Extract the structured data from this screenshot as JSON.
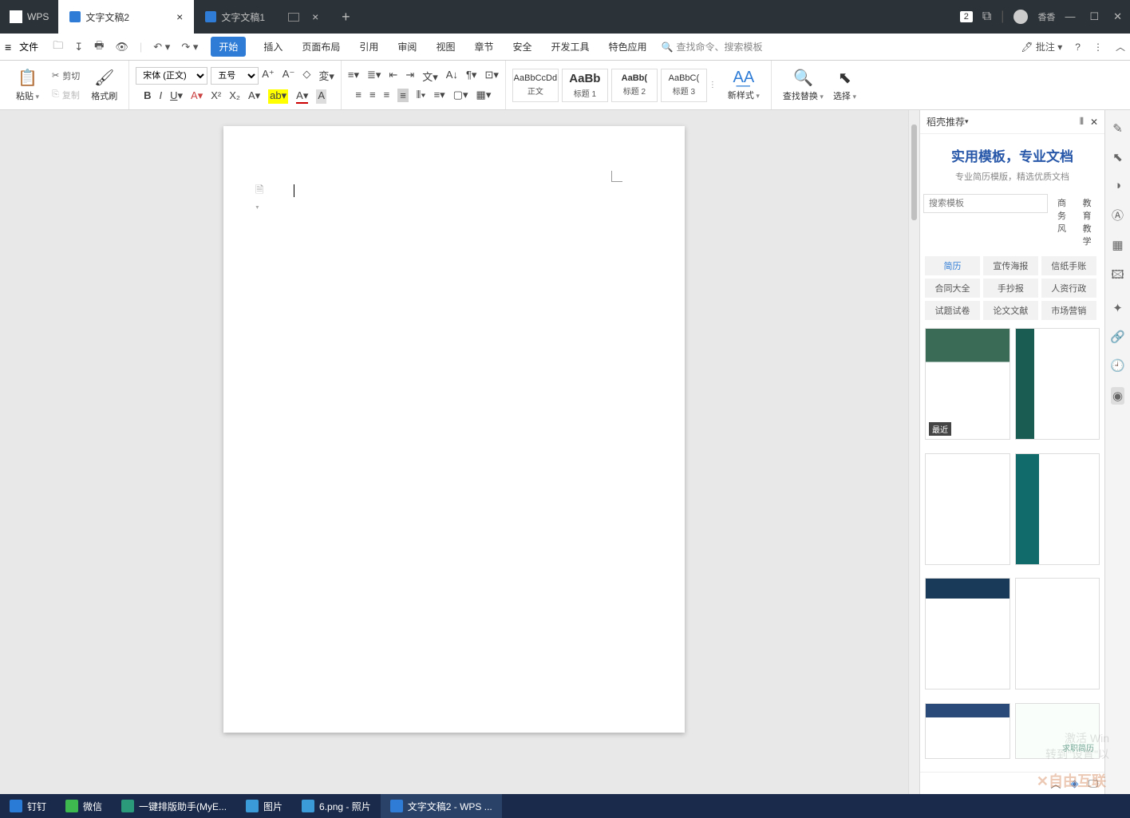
{
  "titlebar": {
    "app_name": "WPS",
    "tabs": [
      {
        "label": "文字文稿2",
        "active": true
      },
      {
        "label": "文字文稿1",
        "active": false
      }
    ],
    "notification_count": "2",
    "user_name": "香香"
  },
  "menubar": {
    "file_label": "文件",
    "tabs": [
      "开始",
      "插入",
      "页面布局",
      "引用",
      "审阅",
      "视图",
      "章节",
      "安全",
      "开发工具",
      "特色应用"
    ],
    "active_tab": "开始",
    "search_placeholder": "查找命令、搜索模板",
    "annotate_label": "批注"
  },
  "ribbon": {
    "paste": "粘贴",
    "cut": "剪切",
    "copy": "复制",
    "format_painter": "格式刷",
    "font_name": "宋体 (正文)",
    "font_size": "五号",
    "styles": [
      {
        "preview": "AaBbCcDd",
        "label": "正文"
      },
      {
        "preview": "AaBb",
        "label": "标题 1"
      },
      {
        "preview": "AaBb(",
        "label": "标题 2"
      },
      {
        "preview": "AaBbC(",
        "label": "标题 3"
      }
    ],
    "new_style": "新样式",
    "find_replace": "查找替换",
    "select": "选择"
  },
  "rightpanel": {
    "title": "稻壳推荐",
    "promo_title": "实用模板，专业文档",
    "promo_sub": "专业简历模版，精选优质文档",
    "search_placeholder": "搜索模板",
    "chips": [
      "商务风",
      "教育教学"
    ],
    "tags": [
      "简历",
      "宣传海报",
      "信纸手账",
      "合同大全",
      "手抄报",
      "人资行政",
      "试题试卷",
      "论文文献",
      "市场营销"
    ],
    "recent_badge": "最近",
    "seek_job": "求职简历"
  },
  "watermark": {
    "line1": "激活 Win",
    "line2": "转到\"设置\"以"
  },
  "taskbar": {
    "items": [
      {
        "label": "钉钉",
        "icon_color": "#2a7bd6"
      },
      {
        "label": "微信",
        "icon_color": "#3eb94f"
      },
      {
        "label": "一键排版助手(MyE...",
        "icon_color": "#2a9a7a"
      },
      {
        "label": "图片",
        "icon_color": "#3a9bd8"
      },
      {
        "label": "6.png - 照片",
        "icon_color": "#3a9bd8"
      },
      {
        "label": "文字文稿2 - WPS ...",
        "icon_color": "#2e7cd6",
        "active": true
      }
    ]
  }
}
